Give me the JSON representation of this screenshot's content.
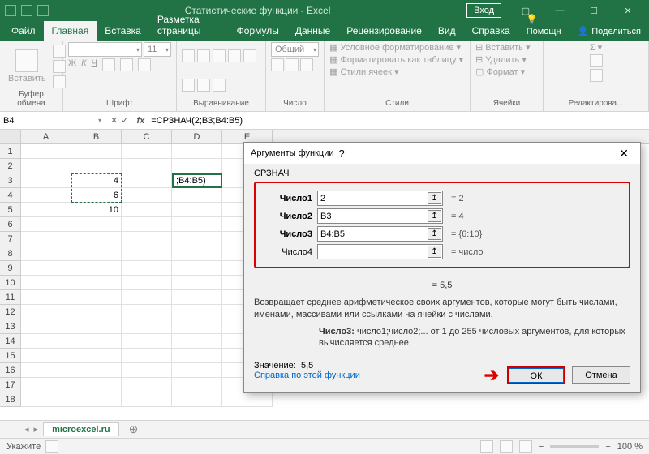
{
  "titlebar": {
    "title": "Статистические функции - Excel",
    "login": "Вход"
  },
  "tabs": {
    "file": "Файл",
    "home": "Главная",
    "insert": "Вставка",
    "layout": "Разметка страницы",
    "formulas": "Формулы",
    "data": "Данные",
    "review": "Рецензирование",
    "view": "Вид",
    "help": "Справка",
    "tellme": "Помощн",
    "share": "Поделиться"
  },
  "ribbon": {
    "clipboard": {
      "label": "Буфер обмена",
      "paste": "Вставить"
    },
    "font": {
      "label": "Шрифт",
      "size": "11",
      "bold": "Ж",
      "italic": "К",
      "underline": "Ч"
    },
    "align": {
      "label": "Выравнивание"
    },
    "number": {
      "label": "Число",
      "format": "Общий"
    },
    "styles": {
      "label": "Стили",
      "cond": "Условное форматирование",
      "table": "Форматировать как таблицу",
      "cell": "Стили ячеек"
    },
    "cells": {
      "label": "Ячейки",
      "ins": "Вставить",
      "del": "Удалить",
      "fmt": "Формат"
    },
    "editing": {
      "label": "Редактирова..."
    }
  },
  "namebox": "B4",
  "formula": "=СРЗНАЧ(2;B3;B4:B5)",
  "cells": {
    "b3": "4",
    "b4": "6",
    "b5": "10",
    "d3": ";B4:B5)"
  },
  "sheet": "microexcel.ru",
  "status": {
    "mode": "Укажите",
    "zoom": "100 %"
  },
  "dialog": {
    "title": "Аргументы функции",
    "fn": "СРЗНАЧ",
    "args": [
      {
        "label": "Число1",
        "value": "2",
        "result": "= 2"
      },
      {
        "label": "Число2",
        "value": "B3",
        "result": "= 4"
      },
      {
        "label": "Число3",
        "value": "B4:B5",
        "result": "= {6:10}"
      },
      {
        "label": "Число4",
        "value": "",
        "result": "= число"
      }
    ],
    "eq": "= 5,5",
    "desc1": "Возвращает среднее арифметическое своих аргументов, которые могут быть числами, именами, массивами или ссылками на ячейки с числами.",
    "desc2l": "Число3:",
    "desc2": "число1;число2;... от 1 до 255 числовых аргументов, для которых вычисляется среднее.",
    "result_lbl": "Значение:",
    "result": "5,5",
    "help": "Справка по этой функции",
    "ok": "ОК",
    "cancel": "Отмена"
  }
}
